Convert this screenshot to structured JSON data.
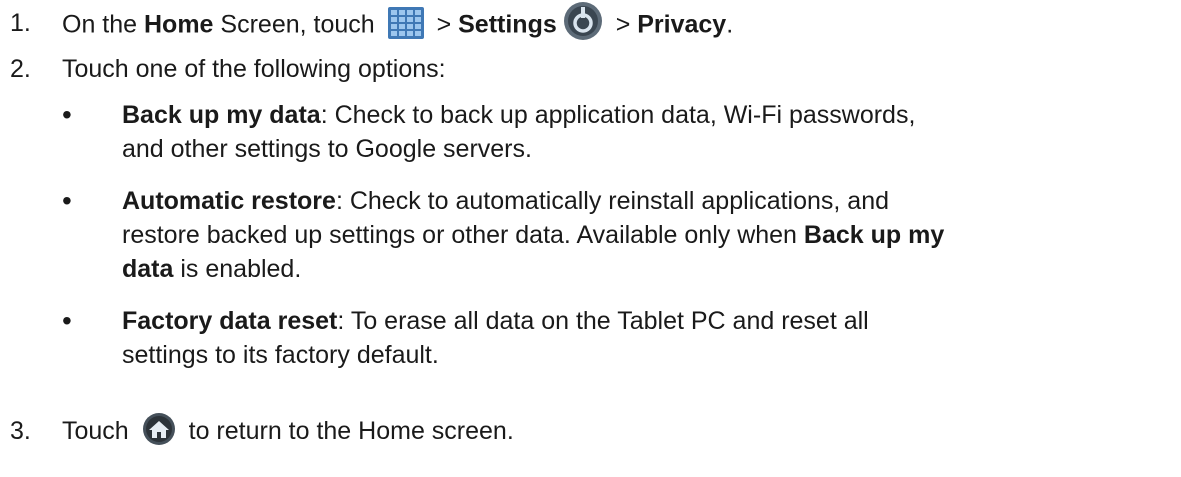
{
  "steps": [
    {
      "number": "1.",
      "text_pre": "On the ",
      "home_bold": "Home",
      "text_after_home": " Screen, touch ",
      "sep1": " > ",
      "settings_bold": "Settings",
      "sep2": " > ",
      "privacy_bold": "Privacy",
      "end": ".",
      "icons": [
        "apps-grid-icon",
        "settings-icon"
      ]
    },
    {
      "number": "2.",
      "text": "Touch one of the following options:"
    },
    {
      "number": "3.",
      "text_pre": "Touch ",
      "text_post": " to return to the Home screen.",
      "icons": [
        "home-icon"
      ]
    }
  ],
  "bullets": [
    {
      "title": "Back up my data",
      "line1": ": Check to back up application data, Wi-Fi passwords,",
      "line2": "and other settings to Google servers."
    },
    {
      "title": "Automatic restore",
      "line1": ": Check to automatically reinstall applications, and",
      "line2_pre": "restore backed up settings or other data. Available only when ",
      "bold_ref_1": "Back up my",
      "bold_ref_2": "data",
      "line3_post": " is enabled."
    },
    {
      "title": "Factory data reset",
      "line1": ": To erase all data on the Tablet PC and reset all",
      "line2": "settings to its factory default."
    }
  ],
  "bullet_char": "•",
  "colors": {
    "text": "#1a1a1a",
    "icon_blue": "#4a86c8",
    "icon_dark": "#2a2a2a"
  }
}
